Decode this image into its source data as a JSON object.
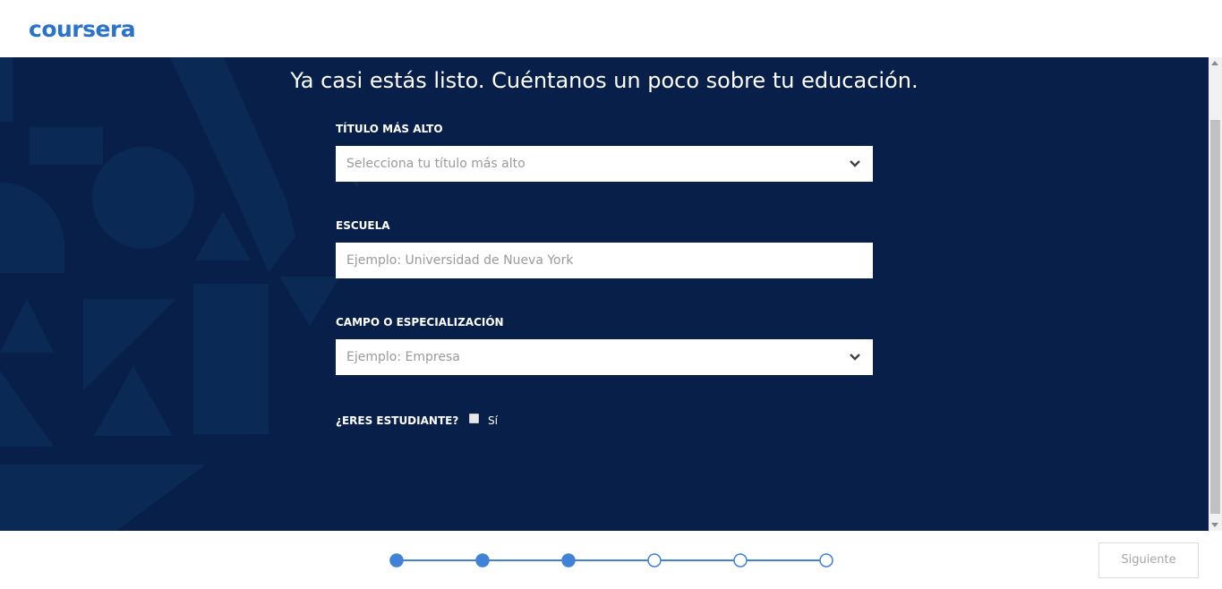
{
  "header": {
    "logo_text": "coursera"
  },
  "main": {
    "title": "Ya casi estás listo. Cuéntanos un poco sobre tu educación.",
    "fields": {
      "degree": {
        "label": "TÍTULO MÁS ALTO",
        "placeholder": "Selecciona tu título más alto",
        "icon": "chevron-down-icon"
      },
      "school": {
        "label": "ESCUELA",
        "placeholder": "Ejemplo: Universidad de Nueva York"
      },
      "major": {
        "label": "CAMPO O ESPECIALIZACIÓN",
        "placeholder": "Ejemplo: Empresa",
        "icon": "chevron-down-icon"
      }
    },
    "student": {
      "label": "¿ERES ESTUDIANTE?",
      "option_label": "Sí",
      "checked": false
    }
  },
  "footer": {
    "progress": {
      "total_steps": 6,
      "completed_steps": 3
    },
    "next_label": "Siguiente"
  },
  "colors": {
    "brand": "#2a73cc",
    "background": "#082049",
    "step_active": "#3f82d6",
    "button_text_disabled": "#a6a6a6"
  }
}
